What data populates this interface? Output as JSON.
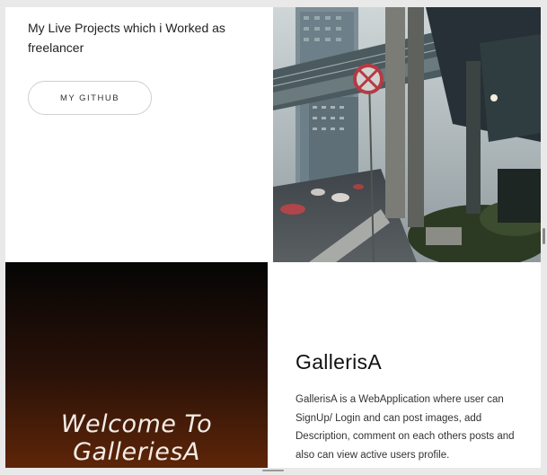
{
  "intro": {
    "text": "My Live Projects which i Worked as freelancer",
    "github_button": "MY GITHUB"
  },
  "photo": {
    "subject": "city street under elevated walkway with no-parking sign"
  },
  "welcome_card": {
    "title_line1": "Welcome To",
    "title_line2": "GalleriesA"
  },
  "project": {
    "title": "GallerisA",
    "description": "GallerisA is a WebApplication where user can SignUp/ Login and can post images, add Description, comment on each others posts and also can view active users profile."
  },
  "colors": {
    "card_gradient_top": "#050505",
    "card_gradient_bottom": "#5e2508",
    "page_background": "#e9e9e9"
  }
}
